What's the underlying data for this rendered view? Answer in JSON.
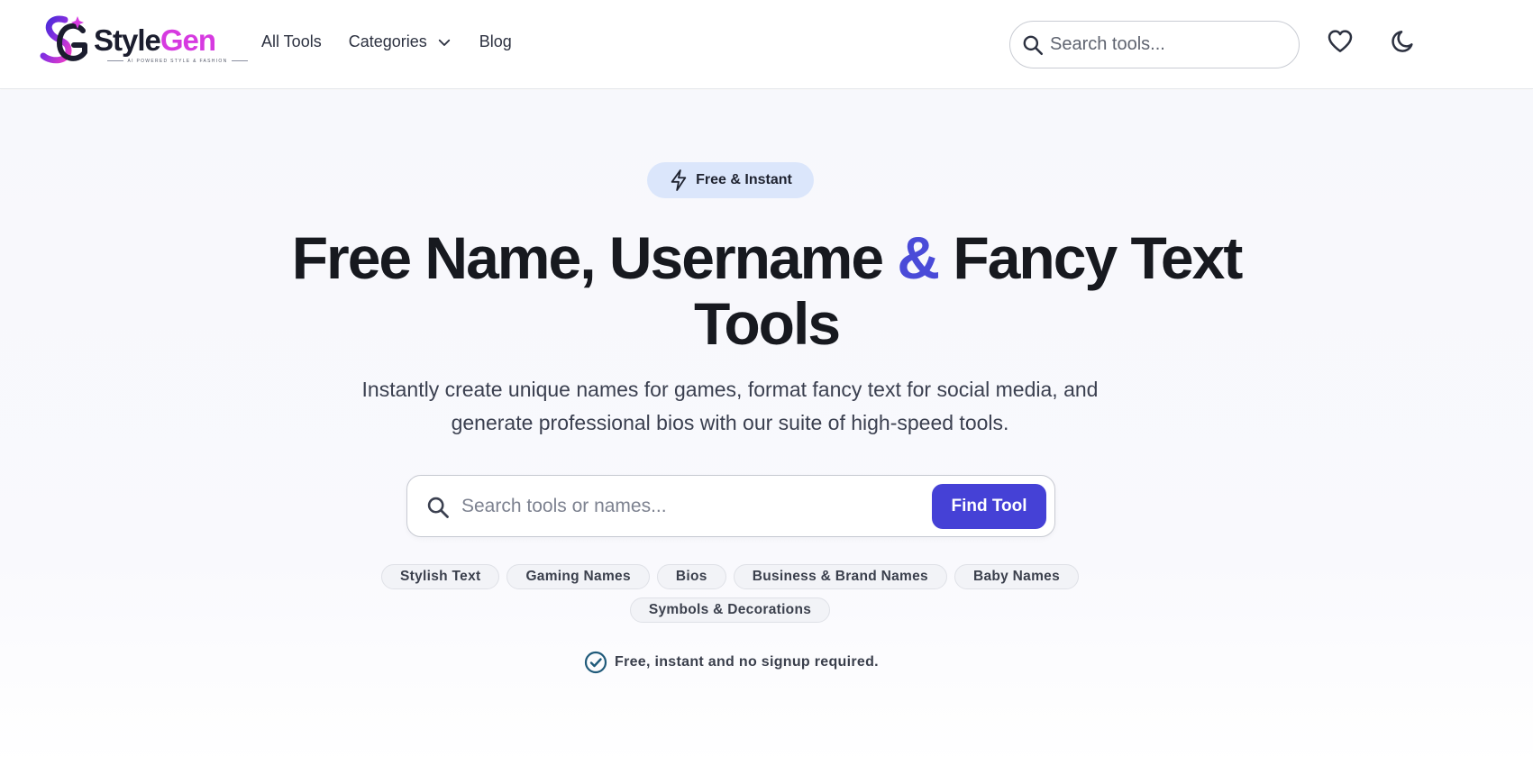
{
  "header": {
    "logo": {
      "word_part1": "Style",
      "word_part2": "Gen",
      "tagline": "AI POWERED STYLE & FASHION",
      "icon": "sg-monogram-logo"
    },
    "nav": [
      {
        "label": "All Tools"
      },
      {
        "label": "Categories",
        "icon": "chevron-down-icon"
      },
      {
        "label": "Blog"
      }
    ],
    "search": {
      "placeholder": "Search tools...",
      "value": "",
      "icon": "search-icon"
    },
    "favorites_icon": "heart-icon",
    "theme_icon": "moon-icon"
  },
  "hero": {
    "badge": {
      "label": "Free & Instant",
      "icon": "lightning-bolt-icon"
    },
    "title_part1": "Free Name, Username ",
    "title_amp": "&",
    "title_part2": " Fancy Text Tools",
    "subtitle": "Instantly create unique names for games, format fancy text for social media, and generate professional bios with our suite of high-speed tools.",
    "search": {
      "placeholder": "Search tools or names...",
      "value": "",
      "button_label": "Find Tool",
      "icon": "search-icon"
    },
    "chips": [
      {
        "label": "Stylish Text"
      },
      {
        "label": "Gaming Names"
      },
      {
        "label": "Bios"
      },
      {
        "label": "Business & Brand Names"
      },
      {
        "label": "Baby Names"
      },
      {
        "label": "Symbols & Decorations"
      }
    ],
    "note": {
      "text": "Free, instant and no signup required.",
      "icon": "check-circle-icon"
    }
  },
  "colors": {
    "accent": "#4541d6",
    "badge_bg": "#dbe6fb",
    "brand_pink": "#d63ae0",
    "check_teal": "#1f5a7a"
  }
}
